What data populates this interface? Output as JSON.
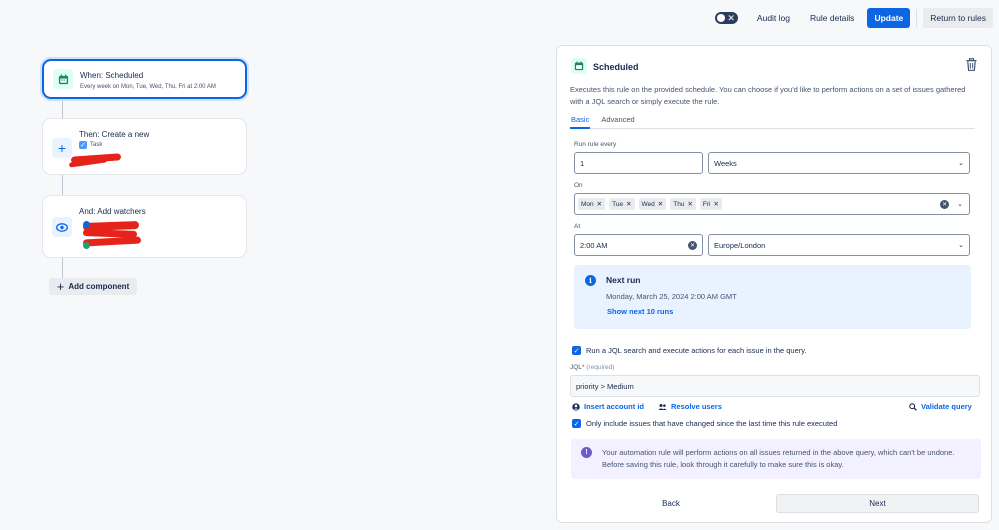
{
  "topbar": {
    "toggle_icon": "close-icon",
    "audit_log": "Audit log",
    "rule_details": "Rule details",
    "update": "Update",
    "return": "Return to rules"
  },
  "flow": {
    "trigger": {
      "title": "When: Scheduled",
      "subtitle": "Every week on Mon, Tue, Wed, Thu, Fri at 2:00 AM",
      "icon": "calendar-icon"
    },
    "action1": {
      "title": "Then: Create a new",
      "issue_type": "Task",
      "icon": "plus-icon"
    },
    "action2": {
      "title": "And: Add watchers",
      "icon": "eye-icon"
    },
    "add_component": "Add component"
  },
  "panel": {
    "title": "Scheduled",
    "description": "Executes this rule on the provided schedule. You can choose if you'd like to perform actions on a set of issues gathered with a JQL search or simply execute the rule.",
    "tabs": [
      "Basic",
      "Advanced"
    ],
    "active_tab": "Basic",
    "run_rule_every_label": "Run rule every",
    "run_rule_every_value": "1",
    "period_value": "Weeks",
    "on_label": "On",
    "days": [
      "Mon",
      "Tue",
      "Wed",
      "Thu",
      "Fri"
    ],
    "at_label": "At",
    "time_value": "2:00 AM",
    "timezone_value": "Europe/London",
    "next_run": {
      "title": "Next run",
      "date": "Monday, March 25, 2024 2:00 AM GMT",
      "link": "Show next 10 runs"
    },
    "jql_checkbox_label": "Run a JQL search and execute actions for each issue in the query.",
    "jql_label": "JQL",
    "jql_required": "(required)",
    "jql_value": "priority > Medium",
    "insert_account_id": "Insert account id",
    "resolve_users": "Resolve users",
    "validate_query": "Validate query",
    "only_changed_label": "Only include issues that have changed since the last time this rule executed",
    "warning_text": "Your automation rule will perform actions on all issues returned in the above query, which can't be undone. Before saving this rule, look through it carefully to make sure this is okay.",
    "back": "Back",
    "next": "Next"
  },
  "colors": {
    "primary": "#0c66e4",
    "info_bg": "#e9f2ff",
    "warning_bg": "#f3f0ff",
    "trigger_icon_bg": "#dcfff1",
    "redaction": "#e5231b"
  }
}
